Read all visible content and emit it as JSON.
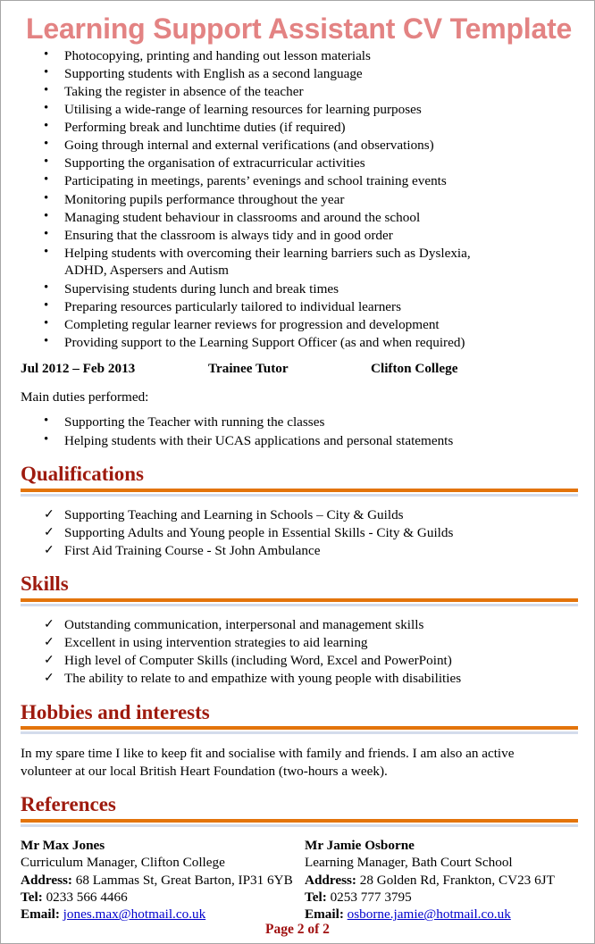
{
  "document": {
    "title": "Learning Support Assistant CV Template",
    "footer": "Page 2 of 2"
  },
  "colors": {
    "title": "#E38383",
    "heading": "#9E1A0E",
    "rule_orange": "#E3740B",
    "rule_blue": "#D3DCEC",
    "link": "#0000CC",
    "footer": "#A01010"
  },
  "duties": {
    "items": [
      "Photocopying, printing and handing out lesson materials",
      "Supporting students with English as a second language",
      "Taking the register in absence of the teacher",
      "Utilising a wide-range of learning resources for learning purposes",
      "Performing break and lunchtime duties (if required)",
      "Going through internal and external verifications (and observations)",
      "Supporting the organisation of extracurricular activities",
      "Participating in meetings, parents’ evenings and school training events",
      "Monitoring pupils performance throughout the year",
      "Managing student behaviour in classrooms and around the school",
      "Ensuring that the classroom is always tidy and in good order",
      "Helping students with overcoming their learning barriers such as Dyslexia, ADHD, Aspersers and Autism",
      "Supervising students during lunch and break times",
      "Preparing resources particularly tailored to individual learners",
      "Completing regular learner reviews for progression and development",
      "Providing support to the Learning Support Officer (as and when required)"
    ]
  },
  "job": {
    "dates": "Jul 2012 – Feb 2013",
    "title": "Trainee Tutor",
    "organisation": "Clifton College",
    "duties_intro": "Main duties performed:",
    "duties": [
      "Supporting the Teacher with running the classes",
      "Helping students with their  UCAS applications and personal statements"
    ]
  },
  "qualifications": {
    "heading": "Qualifications",
    "items": [
      "Supporting Teaching and Learning in Schools – City & Guilds",
      "Supporting Adults and Young people in Essential Skills - City & Guilds",
      "First Aid Training Course - St John Ambulance"
    ]
  },
  "skills": {
    "heading": "Skills",
    "items": [
      "Outstanding communication, interpersonal and management skills",
      "Excellent in using intervention strategies to aid learning",
      "High level of Computer Skills (including Word, Excel and PowerPoint)",
      "The ability to relate to and empathize with young people with disabilities"
    ]
  },
  "hobbies": {
    "heading": "Hobbies and interests",
    "text": "In my spare time I like to keep fit and socialise with family and friends. I am also an active volunteer at our local British Heart Foundation (two-hours a week)."
  },
  "references": {
    "heading": "References",
    "address_label": "Address:",
    "tel_label": "Tel:",
    "email_label": "Email:",
    "left": {
      "name": "Mr Max Jones",
      "role": "Curriculum Manager, Clifton College",
      "address": "68 Lammas St, Great Barton, IP31 6YB",
      "tel": "0233 566 4466",
      "email": "jones.max@hotmail.co.uk"
    },
    "right": {
      "name": "Mr Jamie Osborne",
      "role": "Learning Manager, Bath Court School",
      "address": "28 Golden Rd, Frankton, CV23 6JT",
      "tel": "0253 777 3795",
      "email": "osborne.jamie@hotmail.co.uk"
    }
  }
}
